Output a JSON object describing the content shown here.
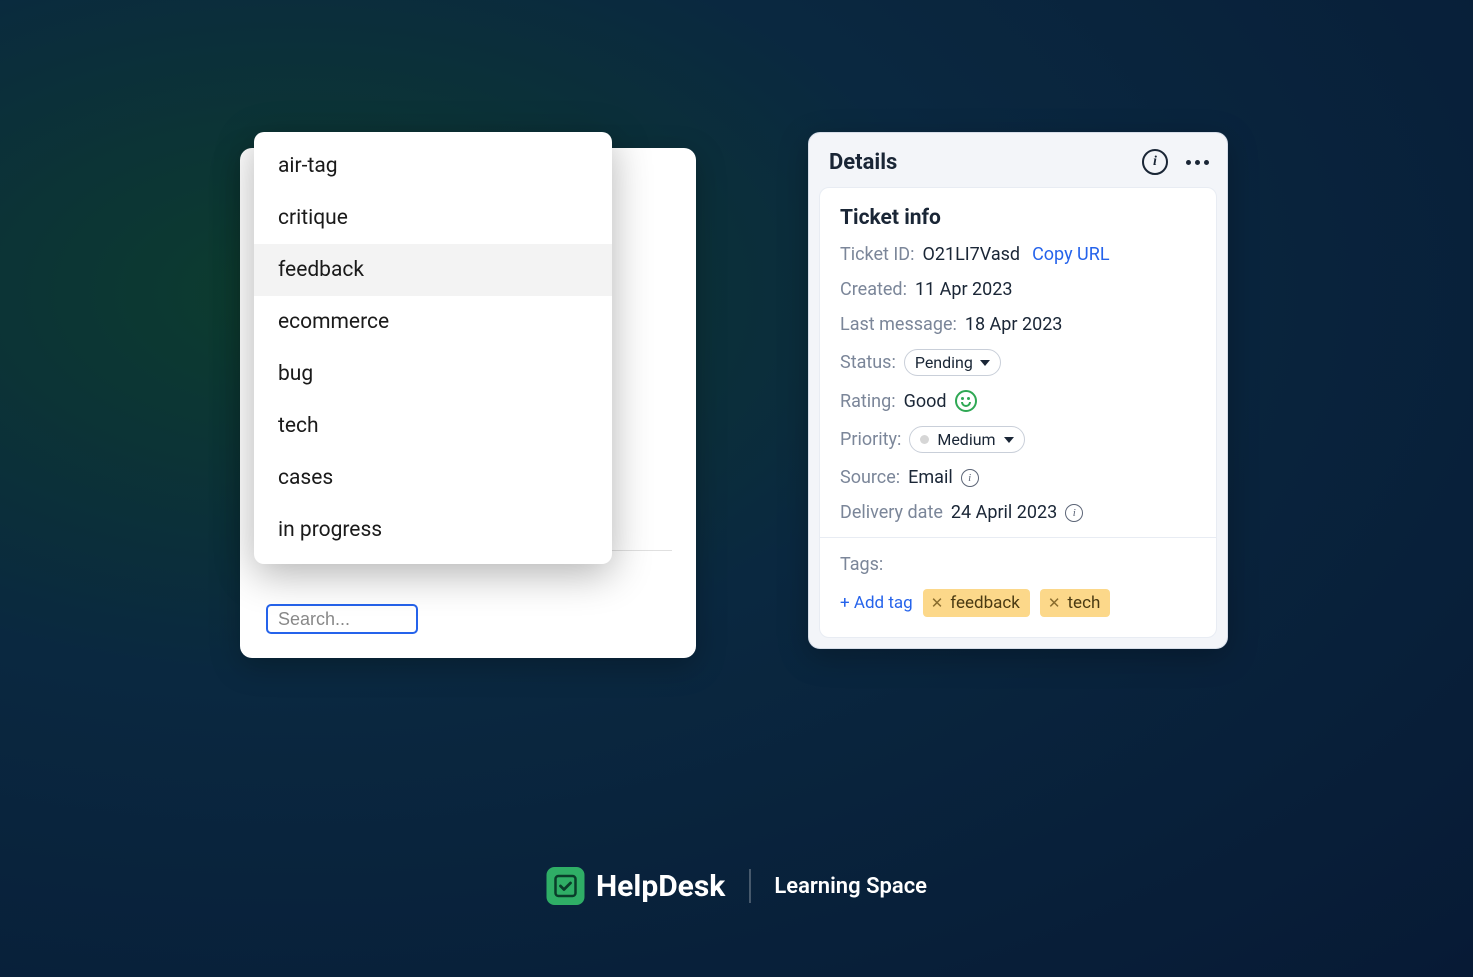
{
  "dropdown": {
    "items": [
      "air-tag",
      "critique",
      "feedback",
      "ecommerce",
      "bug",
      "tech",
      "cases",
      "in progress"
    ],
    "highlighted_index": 2
  },
  "search": {
    "placeholder": "Search..."
  },
  "details": {
    "header_title": "Details",
    "ticket_info_title": "Ticket info",
    "ticket_id_label": "Ticket ID:",
    "ticket_id_value": "O21LI7Vasd",
    "copy_url": "Copy URL",
    "created_label": "Created:",
    "created_value": "11 Apr 2023",
    "last_message_label": "Last message:",
    "last_message_value": "18 Apr 2023",
    "status_label": "Status:",
    "status_value": "Pending",
    "rating_label": "Rating:",
    "rating_value": "Good",
    "priority_label": "Priority:",
    "priority_value": "Medium",
    "source_label": "Source:",
    "source_value": "Email",
    "delivery_label": "Delivery date",
    "delivery_value": "24 April 2023",
    "tags_label": "Tags:",
    "add_tag": "+ Add tag",
    "tags": [
      "feedback",
      "tech"
    ]
  },
  "footer": {
    "brand": "HelpDesk",
    "sub": "Learning Space"
  }
}
